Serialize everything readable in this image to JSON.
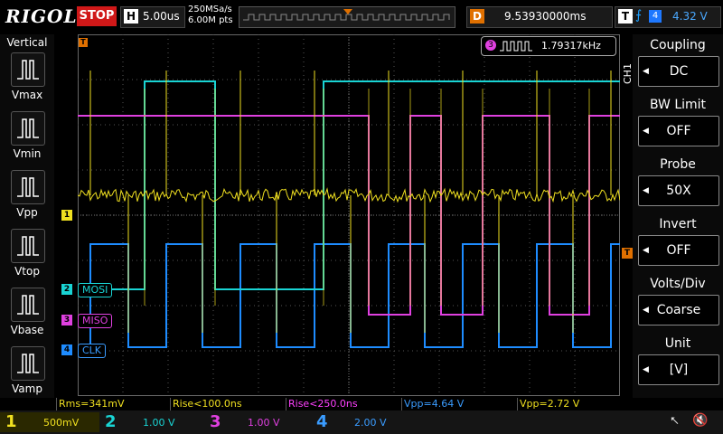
{
  "header": {
    "brand": "RIGOL",
    "run_state": "STOP",
    "timebase_label": "H",
    "timebase": "5.00us",
    "sample_rate": "250MSa/s",
    "memory_depth": "6.00M pts",
    "delay_label": "D",
    "delay": "9.53930000ms",
    "trigger_label": "T",
    "trigger_source": "4",
    "trigger_level": "4.32 V"
  },
  "left_panel": {
    "title": "Vertical",
    "items": [
      {
        "label": "Vmax"
      },
      {
        "label": "Vmin"
      },
      {
        "label": "Vpp"
      },
      {
        "label": "Vtop"
      },
      {
        "label": "Vbase"
      },
      {
        "label": "Vamp"
      }
    ]
  },
  "right_panel": {
    "channel": "CH1",
    "groups": [
      {
        "title": "Coupling",
        "value": "DC"
      },
      {
        "title": "BW Limit",
        "value": "OFF"
      },
      {
        "title": "Probe",
        "value": "50X"
      },
      {
        "title": "Invert",
        "value": "OFF"
      },
      {
        "title": "Volts/Div",
        "value": "Coarse"
      },
      {
        "title": "Unit",
        "value": "[V]"
      }
    ]
  },
  "frequency_counter": {
    "channel": "3",
    "value": "1.79317kHz"
  },
  "channel_tags": {
    "mosi": "MOSI",
    "miso": "MISO",
    "clk": "CLK",
    "ch1_marker": "1",
    "ch2_marker": "2",
    "ch3_marker": "3",
    "ch4_marker": "4",
    "trigger_marker": "T"
  },
  "measurements": [
    {
      "text": "Rms=341mV",
      "color": "#f0e020"
    },
    {
      "text": "Rise<100.0ns",
      "color": "#f0e020"
    },
    {
      "text": "Rise<250.0ns",
      "color": "#ff40ff"
    },
    {
      "text": "Vpp=4.64 V",
      "color": "#3a9cff"
    },
    {
      "text": "Vpp=2.72 V",
      "color": "#f0e020"
    }
  ],
  "bottom": {
    "channels": [
      {
        "num": "1",
        "scale": "500mV",
        "color": "#f0e020"
      },
      {
        "num": "2",
        "scale": "1.00 V",
        "color": "#19d4d4"
      },
      {
        "num": "3",
        "scale": "1.00 V",
        "color": "#e040e0"
      },
      {
        "num": "4",
        "scale": "2.00 V",
        "color": "#3a9cff"
      }
    ]
  },
  "colors": {
    "ch1": "#f0e020",
    "ch2": "#19d4d4",
    "ch3": "#e040e0",
    "ch4": "#1e8cff",
    "trigger": "#e07000"
  }
}
